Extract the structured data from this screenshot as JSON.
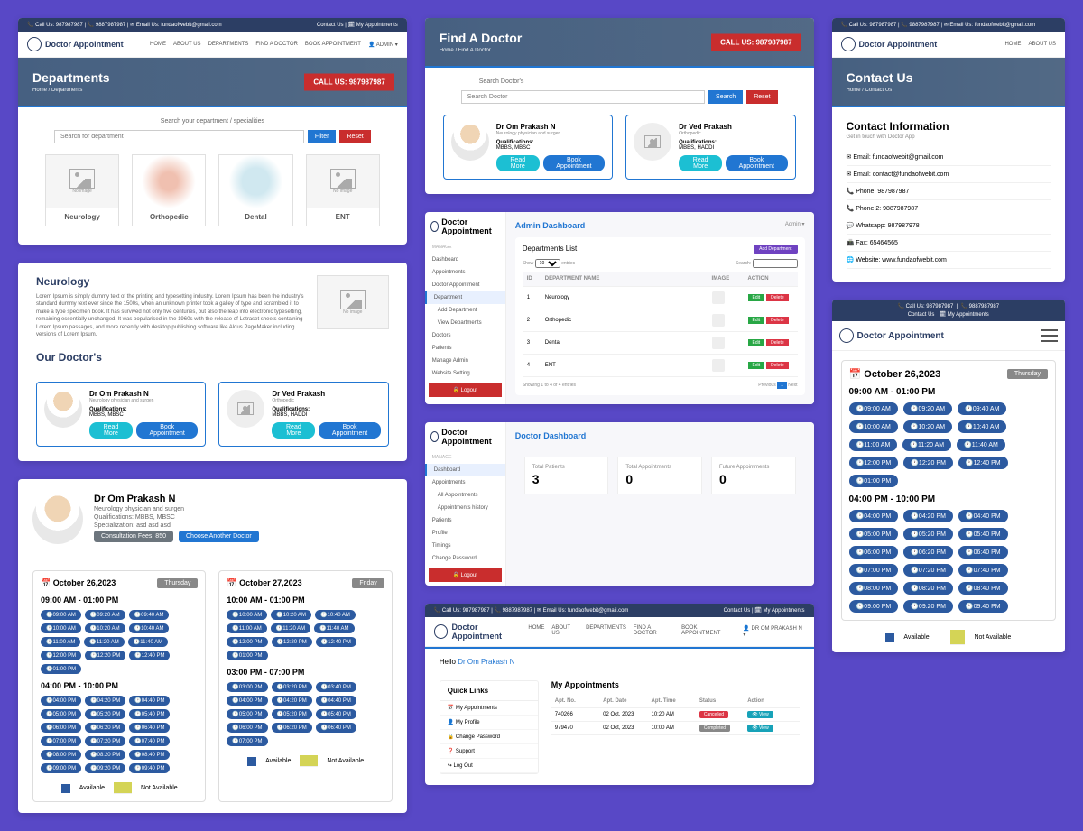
{
  "topbar": {
    "phone1": "📞 Call Us: 987987987",
    "phone2": "📞 9887987987",
    "email": "✉ Email Us: fundaofwebit@gmail.com",
    "contact": "Contact Us",
    "myapts": "🗓 My Appointments"
  },
  "brand": "Doctor Appointment",
  "nav": [
    "HOME",
    "ABOUT US",
    "DEPARTMENTS",
    "FIND A DOCTOR",
    "BOOK APPOINTMENT"
  ],
  "navUser": "👤 ADMIN ▾",
  "navUser2": "👤 DR OM PRAKASH N ▾",
  "callus": "CALL US: 987987987",
  "panel1": {
    "title": "Departments",
    "bc": "Home  /  Departments",
    "searchLbl": "Search your department / specialities",
    "placeholder": "Search for department",
    "filter": "Filter",
    "reset": "Reset",
    "depts": [
      "Neurology",
      "Orthopedic",
      "Dental",
      "ENT"
    ],
    "noimg": "No image"
  },
  "panel2": {
    "title": "Neurology",
    "lorem": "Lorem Ipsum is simply dummy text of the printing and typesetting industry. Lorem Ipsum has been the industry's standard dummy text ever since the 1500s, when an unknown printer took a galley of type and scrambled it to make a type specimen book. It has survived not only five centuries, but also the leap into electronic typesetting, remaining essentially unchanged. It was popularised in the 1960s with the release of Letraset sheets containing Lorem Ipsum passages, and more recently with desktop publishing software like Aldus PageMaker including versions of Lorem Ipsum.",
    "noimg": "No image",
    "ourdoctors": "Our Doctor's",
    "doc1": {
      "name": "Dr Om Prakash N",
      "spec": "Neurology physician and surgen",
      "quallbl": "Qualifications:",
      "qual": "MBBS, MBSC"
    },
    "doc2": {
      "name": "Dr Ved Prakash",
      "spec": "Orthopedic",
      "quallbl": "Qualifications:",
      "qual": "MBBS, HADDI"
    },
    "readmore": "Read More",
    "book": "Book Appointment"
  },
  "panel3": {
    "doc": {
      "name": "Dr Om Prakash N",
      "spec": "Neurology physician and surgen",
      "qual": "Qualifications: MBBS, MBSC",
      "special": "Specialization: asd asd asd"
    },
    "feebtn": "Consultation Fees: 850",
    "choose": "Choose Another Doctor",
    "d1": {
      "date": "📅 October 26,2023",
      "day": "Thursday",
      "r1": "09:00 AM - 01:00 PM",
      "s1": [
        "🕐09:00 AM",
        "🕐09:20 AM",
        "🕐09:40 AM",
        "🕐10:00 AM",
        "🕐10:20 AM",
        "🕐10:40 AM",
        "🕐11:00 AM",
        "🕐11:20 AM",
        "🕐11:40 AM",
        "🕐12:00 PM",
        "🕐12:20 PM",
        "🕐12:40 PM",
        "🕐01:00 PM"
      ],
      "r2": "04:00 PM - 10:00 PM",
      "s2": [
        "🕐04:00 PM",
        "🕐04:20 PM",
        "🕐04:40 PM",
        "🕐05:00 PM",
        "🕐05:20 PM",
        "🕐05:40 PM",
        "🕐06:00 PM",
        "🕐06:20 PM",
        "🕐06:40 PM",
        "🕐07:00 PM",
        "🕐07:20 PM",
        "🕐07:40 PM",
        "🕐08:00 PM",
        "🕐08:20 PM",
        "🕐08:40 PM",
        "🕐09:00 PM",
        "🕐09:20 PM",
        "🕐09:40 PM"
      ]
    },
    "d2": {
      "date": "📅 October 27,2023",
      "day": "Friday",
      "r1": "10:00 AM - 01:00 PM",
      "s1": [
        "🕐10:00 AM",
        "🕐10:20 AM",
        "🕐10:40 AM",
        "🕐11:00 AM",
        "🕐11:20 AM",
        "🕐11:40 AM",
        "🕐12:00 PM",
        "🕐12:20 PM",
        "🕐12:40 PM",
        "🕐01:00 PM"
      ],
      "r2": "03:00 PM - 07:00 PM",
      "s2": [
        "🕐03:00 PM",
        "🕐03:20 PM",
        "🕐03:40 PM",
        "🕐04:00 PM",
        "🕐04:20 PM",
        "🕐04:40 PM",
        "🕐05:00 PM",
        "🕐05:20 PM",
        "🕐05:40 PM",
        "🕐06:00 PM",
        "🕐06:20 PM",
        "🕐06:40 PM",
        "🕐07:00 PM"
      ]
    },
    "lav": "Available",
    "lnav": "Not Available"
  },
  "panel4": {
    "title": "Find A Doctor",
    "bc": "Home  /  Find A Doctor",
    "searchLbl": "Search Doctor's",
    "placeholder": "Search Doctor",
    "search": "Search",
    "reset": "Reset",
    "doc1": {
      "name": "Dr Om Prakash N",
      "spec": "Neurology physician and surgen",
      "quallbl": "Qualifications:",
      "qual": "MBBS, MBSC"
    },
    "doc2": {
      "name": "Dr Ved Prakash",
      "spec": "Orthopedic",
      "quallbl": "Qualifications:",
      "qual": "MBBS, HADDI"
    },
    "readmore": "Read More",
    "book": "Book Appointment"
  },
  "panel5": {
    "title": "Admin Dashboard",
    "userlink": "Admin ▾",
    "manage": "MANAGE",
    "menu": [
      "Dashboard",
      "Appointments",
      "Doctor Appointment",
      "Department",
      "Add Department",
      "View Departments",
      "Doctors",
      "Patients",
      "Manage Admin",
      "Website Setting"
    ],
    "logout": "🔓 Logout",
    "listTitle": "Departments List",
    "addbtn": "Add Department",
    "show": "Show",
    "entries": "entries",
    "searchlbl": "Search:",
    "cols": [
      "ID",
      "DEPARTMENT NAME",
      "IMAGE",
      "ACTION"
    ],
    "rows": [
      {
        "id": "1",
        "name": "Neurology"
      },
      {
        "id": "2",
        "name": "Orthopedic"
      },
      {
        "id": "3",
        "name": "Dental"
      },
      {
        "id": "4",
        "name": "ENT"
      }
    ],
    "edit": "Edit",
    "del": "Delete",
    "showing": "Showing 1 to 4 of 4 entries",
    "prev": "Previous",
    "page": "1",
    "next": "Next"
  },
  "panel6": {
    "title": "Doctor Dashboard",
    "manage": "MANAGE",
    "menu": [
      "Dashboard",
      "Appointments",
      "All Appointments",
      "Appointments history",
      "Patients",
      "Profile",
      "Timings",
      "Change Password"
    ],
    "logout": "🔓 Logout",
    "stats": [
      {
        "l": "Total Patients",
        "v": "3"
      },
      {
        "l": "Total Appointments",
        "v": "0"
      },
      {
        "l": "Future Appointments",
        "v": "0"
      }
    ]
  },
  "panel7": {
    "hello": "Hello",
    "username": "Dr Om Prakash N",
    "ql": "Quick Links",
    "links": [
      "📅 My Appointments",
      "👤 My Profile",
      "🔒 Change Password",
      "❓ Support",
      "↪ Log Out"
    ],
    "aptTitle": "My Appointments",
    "cols": [
      "Apt. No.",
      "Apt. Date",
      "Apt. Time",
      "Status",
      "Action"
    ],
    "rows": [
      {
        "no": "740266",
        "date": "02 Oct, 2023",
        "time": "10:20 AM",
        "status": "Cancelled",
        "cls": "cancel"
      },
      {
        "no": "979470",
        "date": "02 Oct, 2023",
        "time": "10:00 AM",
        "status": "Completed",
        "cls": "complete"
      }
    ],
    "view": "👁 View"
  },
  "panel8": {
    "title": "Contact Us",
    "bc": "Home  /  Contact Us",
    "ctitle": "Contact Information",
    "sub": "Get in touch with Doctor App",
    "items": [
      "✉ Email: fundaofwebit@gmail.com",
      "✉ Email: contact@fundaofwebit.com",
      "📞 Phone: 987987987",
      "📞 Phone 2: 9887987987",
      "💬 Whatsapp: 987987978",
      "📠 Fax: 65464565",
      "🌐 Website: www.fundaofwebit.com"
    ]
  },
  "panel9": {
    "date": "📅 October 26,2023",
    "day": "Thursday",
    "r1": "09:00 AM - 01:00 PM",
    "s1": [
      "🕐09:00 AM",
      "🕐09:20 AM",
      "🕐09:40 AM",
      "🕐10:00 AM",
      "🕐10:20 AM",
      "🕐10:40 AM",
      "🕐11:00 AM",
      "🕐11:20 AM",
      "🕐11:40 AM",
      "🕐12:00 PM",
      "🕐12:20 PM",
      "🕐12:40 PM",
      "🕐01:00 PM"
    ],
    "r2": "04:00 PM - 10:00 PM",
    "s2": [
      "🕐04:00 PM",
      "🕐04:20 PM",
      "🕐04:40 PM",
      "🕐05:00 PM",
      "🕐05:20 PM",
      "🕐05:40 PM",
      "🕐06:00 PM",
      "🕐06:20 PM",
      "🕐06:40 PM",
      "🕐07:00 PM",
      "🕐07:20 PM",
      "🕐07:40 PM",
      "🕐08:00 PM",
      "🕐08:20 PM",
      "🕐08:40 PM",
      "🕐09:00 PM",
      "🕐09:20 PM",
      "🕐09:40 PM"
    ],
    "lav": "Available",
    "lnav": "Not Available"
  }
}
